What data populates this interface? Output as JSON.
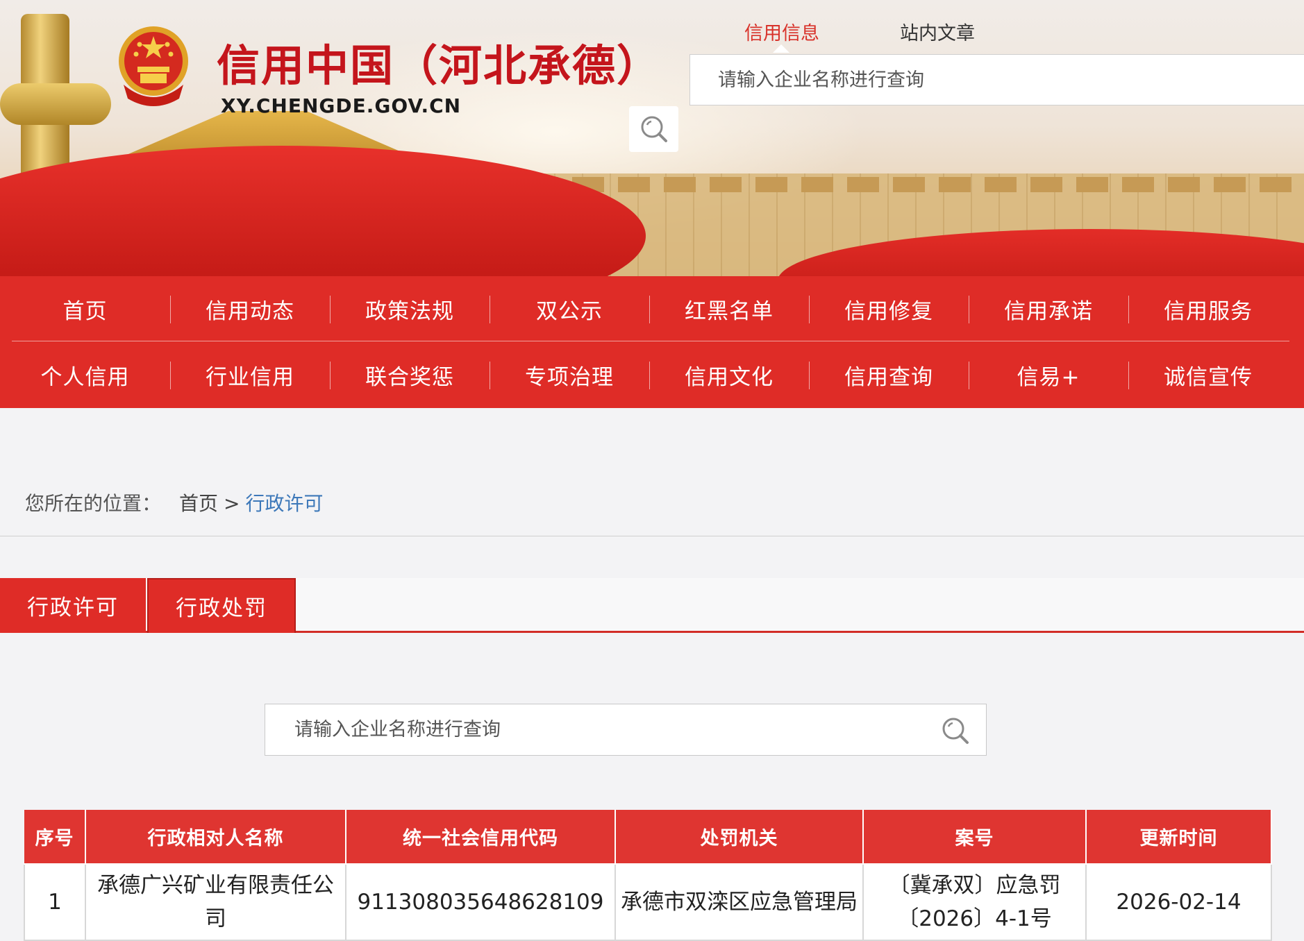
{
  "header": {
    "title": "信用中国（河北承德）",
    "url": "XY.CHENGDE.GOV.CN",
    "tabs": [
      {
        "label": "信用信息",
        "active": true
      },
      {
        "label": "站内文章",
        "active": false
      }
    ],
    "search_placeholder": "请输入企业名称进行查询",
    "search_icon": "search-icon"
  },
  "nav": {
    "row1": [
      "首页",
      "信用动态",
      "政策法规",
      "双公示",
      "红黑名单",
      "信用修复",
      "信用承诺",
      "信用服务"
    ],
    "row2": [
      "个人信用",
      "行业信用",
      "联合奖惩",
      "专项治理",
      "信用文化",
      "信用查询",
      "信易+",
      "诚信宣传"
    ]
  },
  "breadcrumb": {
    "prefix": "您所在的位置：",
    "home": "首页",
    "separator": ">",
    "current": "行政许可"
  },
  "tabs": [
    "行政许可",
    "行政处罚"
  ],
  "content_search": {
    "placeholder": "请输入企业名称进行查询"
  },
  "table": {
    "headers": [
      "序号",
      "行政相对人名称",
      "统一社会信用代码",
      "处罚机关",
      "案号",
      "更新时间"
    ],
    "rows": [
      [
        "1",
        "承德广兴矿业有限责任公司",
        "91130803564862810​9",
        "承德市双滦区应急管理局",
        "〔冀承双〕应急罚〔2026〕4-1号",
        "2026-02-14"
      ]
    ]
  },
  "colors": {
    "brand_red": "#df2c27",
    "title_red": "#c4151c",
    "link_blue": "#3d78b9"
  }
}
